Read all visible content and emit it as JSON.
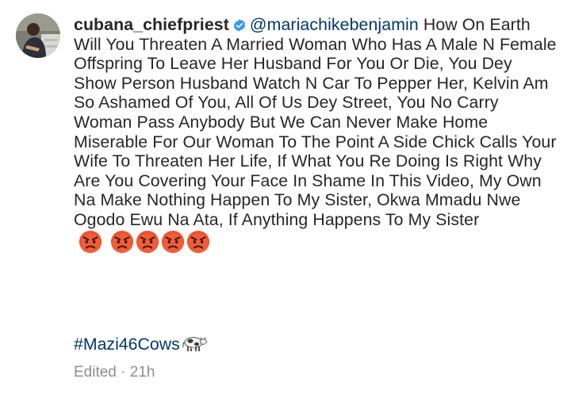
{
  "comment": {
    "username": "cubana_chiefpriest",
    "mention": "@mariachikebenjamin",
    "body": " How On Earth Will You Threaten A Married Woman Who Has A Male N Female Offspring To Leave Her Husband For You Or Die, You Dey Show Person Husband Watch N Car To Pepper Her, Kelvin Am So Ashamed Of You, All Of Us Dey Street, You No Carry Woman Pass Anybody But We Can Never Make Home Miserable For Our Woman To The Point A Side Chick Calls Your Wife To Threaten Her Life, If What You Re Doing Is Right Why Are You Covering Your Face In Shame In This Video, My Own Na Make Nothing Happen To My Sister, Okwa Mmadu Nwe Ogodo Ewu Na Ata, If Anything Happens To My Sister ",
    "emojis": [
      "angry-face-emoji",
      "angry-face-emoji",
      "angry-face-emoji",
      "angry-face-emoji",
      "angry-face-emoji"
    ],
    "hashtag": "#Mazi46Cows",
    "hashtag_emoji": "cow-emoji",
    "edited_label": "Edited",
    "separator": "·",
    "timestamp": "21h"
  },
  "icons": {
    "verified": "verified-badge-icon",
    "avatar": "profile-avatar"
  },
  "colors": {
    "text": "#262626",
    "link": "#00376b",
    "muted": "#8e8e8e",
    "verified_badge": "#3897f0",
    "emoji_face": "#f0502e"
  }
}
